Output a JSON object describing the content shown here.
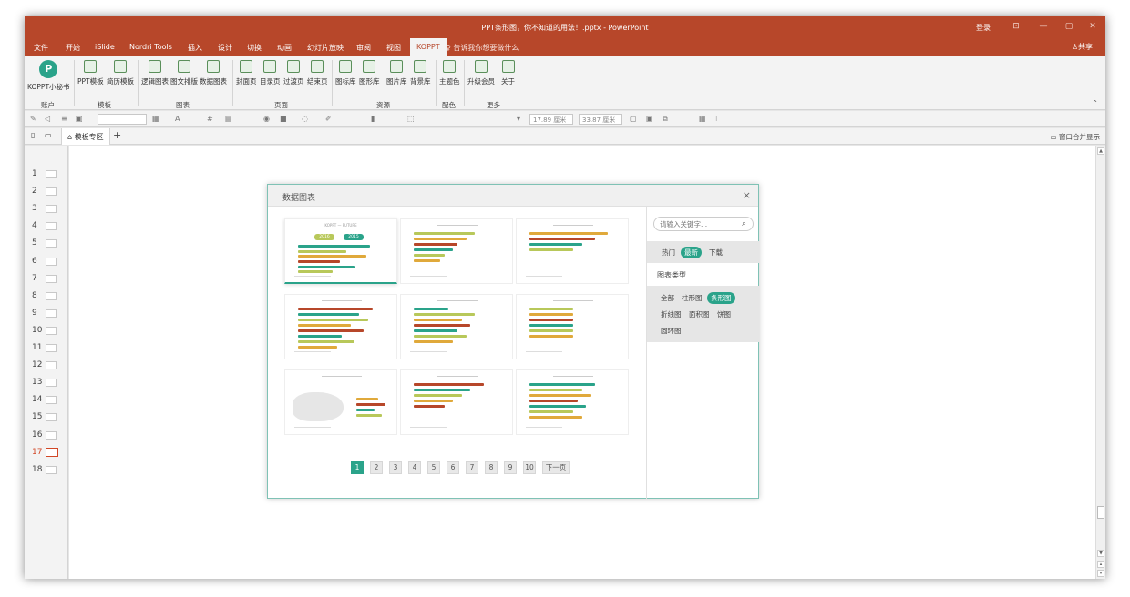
{
  "window": {
    "title": "PPT条形图，你不知道的用法！.pptx - PowerPoint",
    "login": "登录",
    "controls": [
      "⊡",
      "—",
      "▢",
      "✕"
    ]
  },
  "menu": {
    "items": [
      "文件",
      "开始",
      "iSlide",
      "Nordri Tools",
      "插入",
      "设计",
      "切换",
      "动画",
      "幻灯片放映",
      "审阅",
      "视图",
      "KOPPT"
    ],
    "active": "KOPPT",
    "tell_me": "告诉我你想要做什么",
    "share": "共享"
  },
  "ribbon": {
    "buttons": [
      "KOPPT小秘书",
      "PPT模板",
      "简历模板",
      "逻辑图表",
      "图文排版",
      "数据图表",
      "封面页",
      "目录页",
      "过渡页",
      "结束页",
      "图标库",
      "图形库",
      "图片库",
      "背景库",
      "主题色",
      "升级会员",
      "关于"
    ],
    "groups": [
      "账户",
      "模板",
      "图表",
      "页面",
      "资源",
      "配色",
      "更多"
    ]
  },
  "toolbar2": {
    "width_value": "17.89 厘米",
    "height_value": "33.87 厘米"
  },
  "tabs": {
    "tab_label": "模板专区",
    "add": "+",
    "merge_label": "窗口合并显示"
  },
  "slides": [
    "1",
    "2",
    "3",
    "4",
    "5",
    "6",
    "7",
    "8",
    "9",
    "10",
    "11",
    "12",
    "13",
    "14",
    "15",
    "16",
    "17",
    "18"
  ],
  "active_slide": "17",
  "dialog": {
    "title": "数据图表",
    "close": "×",
    "search_placeholder": "请输入关键字...",
    "sort": [
      "热门",
      "最新",
      "下载"
    ],
    "sort_active": "最新",
    "type_heading": "图表类型",
    "types": [
      "全部",
      "柱形图",
      "条形图",
      "折线图",
      "面积图",
      "饼图",
      "圆环图"
    ],
    "type_active": "条形图",
    "pages": [
      "1",
      "2",
      "3",
      "4",
      "5",
      "6",
      "7",
      "8",
      "9",
      "10"
    ],
    "page_active": "1",
    "next": "下一页",
    "first_card_title": "KOPPT 一 FUTURE",
    "first_card_years": [
      "2016",
      "2015"
    ]
  },
  "colors": {
    "accent": "#b7472a",
    "teal": "#2aa38a",
    "olive": "#b8c85a",
    "orange": "#e0a93b",
    "slide_active": "#d24726"
  }
}
